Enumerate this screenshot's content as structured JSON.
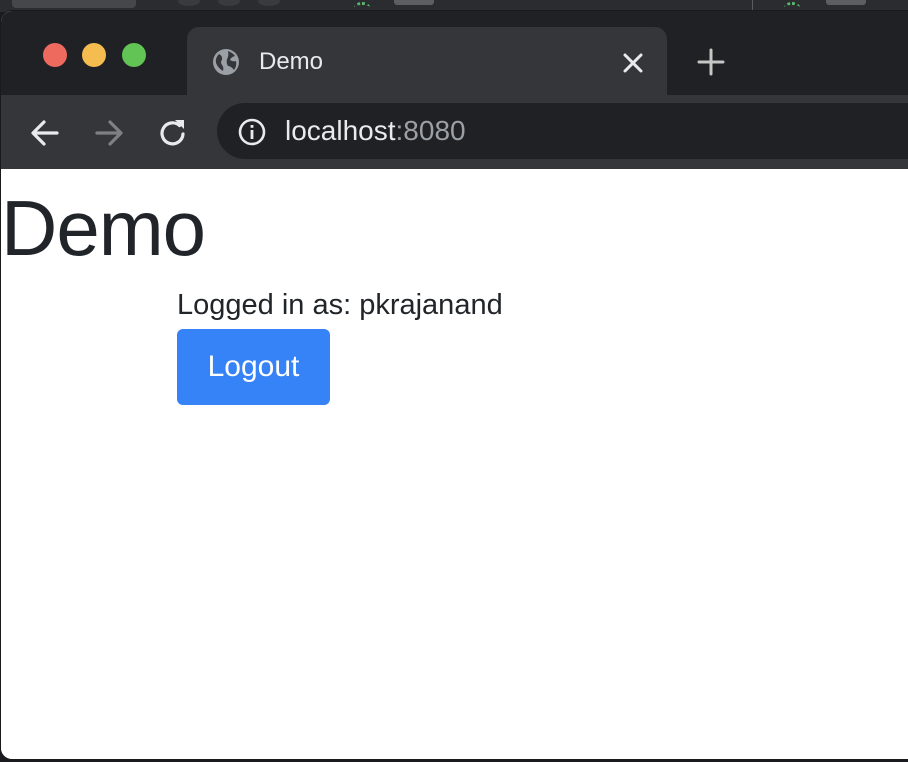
{
  "browser": {
    "tab": {
      "title": "Demo",
      "favicon": "globe-icon",
      "close_icon": "close-icon"
    },
    "new_tab_icon": "plus-icon",
    "nav": {
      "back_icon": "arrow-left-icon",
      "forward_icon": "arrow-right-icon",
      "reload_icon": "reload-icon"
    },
    "address": {
      "info_icon": "info-icon",
      "host": "localhost",
      "port": ":8080"
    },
    "traffic_lights": {
      "close_color": "#ee6a5f",
      "minimize_color": "#f5bd4f",
      "maximize_color": "#61c454"
    }
  },
  "page": {
    "title": "Demo",
    "logged_in_text": "Logged in as: pkrajanand",
    "logout_label": "Logout",
    "accent_color": "#3583f6"
  }
}
